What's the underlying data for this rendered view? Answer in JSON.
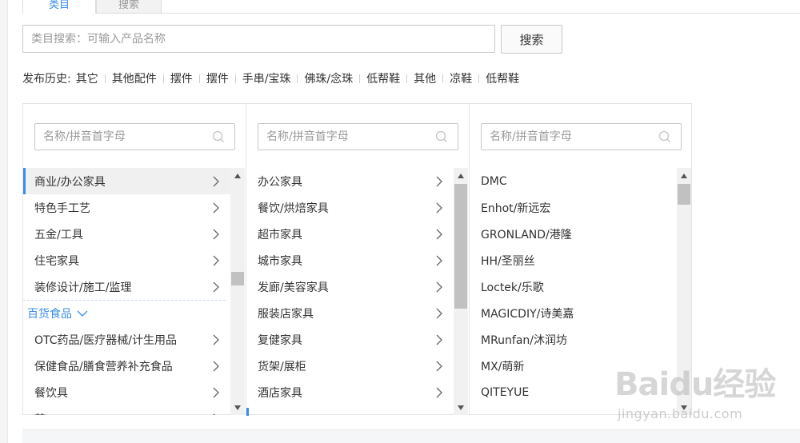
{
  "tabs": [
    {
      "label": "类目",
      "active": true
    },
    {
      "label": "搜索",
      "active": false
    }
  ],
  "search": {
    "placeholder": "类目搜索：可输入产品名称",
    "button_label": "搜索"
  },
  "history": {
    "label": "发布历史:",
    "items": [
      "其它",
      "其他配件",
      "摆件",
      "摆件",
      "手串/宝珠",
      "佛珠/念珠",
      "低帮鞋",
      "其他",
      "凉鞋",
      "低帮鞋"
    ]
  },
  "columns": [
    {
      "filter_placeholder": "名称/拼音首字母",
      "items": [
        {
          "label": "商业/办公家具",
          "active": true
        },
        {
          "label": "特色手工艺"
        },
        {
          "label": "五金/工具"
        },
        {
          "label": "住宅家具"
        },
        {
          "label": "装修设计/施工/监理"
        }
      ],
      "group": {
        "label": "百货食品"
      },
      "items2": [
        {
          "label": "OTC药品/医疗器械/计生用品"
        },
        {
          "label": "保健食品/膳食营养补充食品"
        },
        {
          "label": "餐饮具"
        },
        {
          "label": "茶"
        }
      ]
    },
    {
      "filter_placeholder": "名称/拼音首字母",
      "items": [
        {
          "label": "办公家具"
        },
        {
          "label": "餐饮/烘焙家具"
        },
        {
          "label": "超市家具"
        },
        {
          "label": "城市家具"
        },
        {
          "label": "发廊/美容家具"
        },
        {
          "label": "服装店家具"
        },
        {
          "label": "复健家具"
        },
        {
          "label": "货架/展柜"
        },
        {
          "label": "酒店家具"
        }
      ]
    },
    {
      "filter_placeholder": "名称/拼音首字母",
      "items": [
        {
          "label": "DMC"
        },
        {
          "label": "Enhot/新远宏"
        },
        {
          "label": "GRONLAND/港隆"
        },
        {
          "label": "HH/圣丽丝"
        },
        {
          "label": "Loctek/乐歌"
        },
        {
          "label": "MAGICDIY/诗美嘉"
        },
        {
          "label": "MRunfan/沐润坊"
        },
        {
          "label": "MX/萌新"
        },
        {
          "label": "QITEYUE"
        }
      ]
    }
  ],
  "watermark": {
    "logo": "Baidu经验",
    "url": "jingyan.baidu.com"
  },
  "colors": {
    "accent": "#3a8ee6",
    "border": "#c8c8c8",
    "active_bg": "#f0f0f0"
  }
}
